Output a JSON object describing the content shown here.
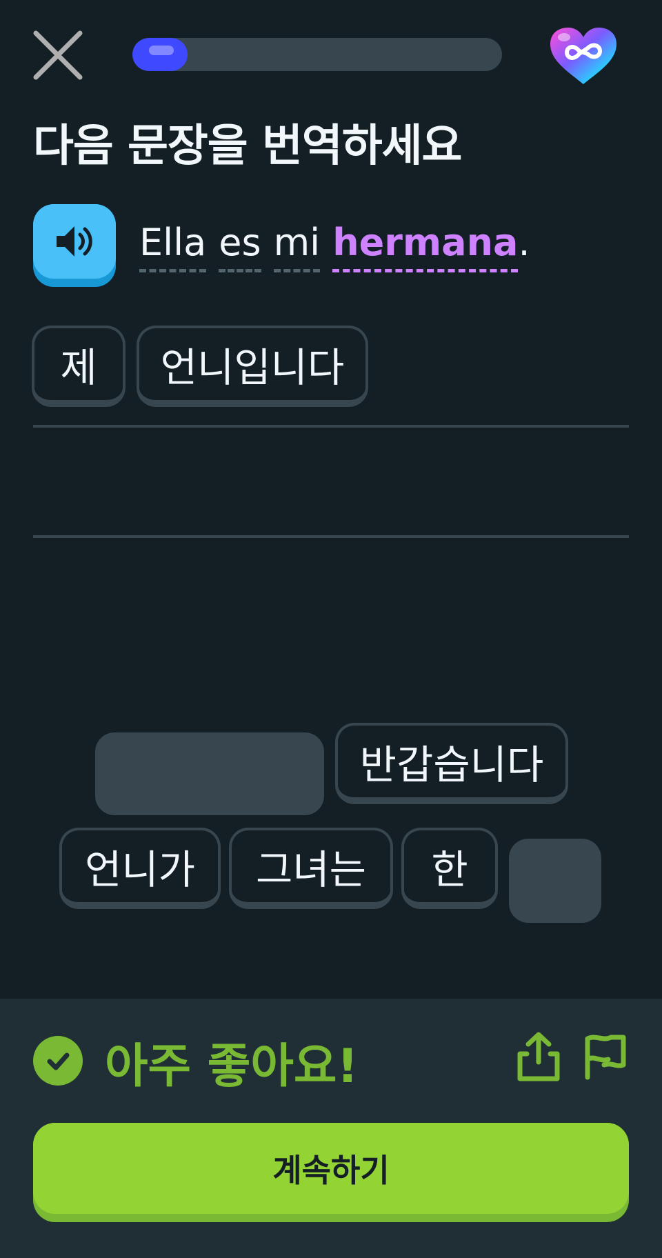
{
  "header": {
    "close_icon": "close-icon",
    "progress_percent": 15,
    "hearts_icon": "infinity-heart-icon",
    "hearts_value": "∞"
  },
  "exercise": {
    "title": "다음 문장을 번역하세요",
    "speaker_icon": "speaker-icon",
    "sentence_words": [
      "Ella",
      "es",
      "mi",
      "hermana"
    ],
    "sentence_end": ".",
    "new_word": "hermana"
  },
  "answer": {
    "selected_tiles": [
      "제",
      "언니입니다"
    ]
  },
  "word_bank": {
    "row1": [
      "반갑습니다"
    ],
    "row2": [
      "언니가",
      "그녀는",
      "한"
    ]
  },
  "feedback": {
    "status_icon": "check-icon",
    "message": "아주 좋아요!",
    "share_icon": "share-icon",
    "flag_icon": "flag-icon",
    "continue_label": "계속하기"
  },
  "colors": {
    "background": "#131f24",
    "panel": "#202f36",
    "progress": "#3f49ff",
    "success": "#79b933",
    "button": "#93d333",
    "new_word": "#ce82ff",
    "speaker": "#49c0f8"
  }
}
